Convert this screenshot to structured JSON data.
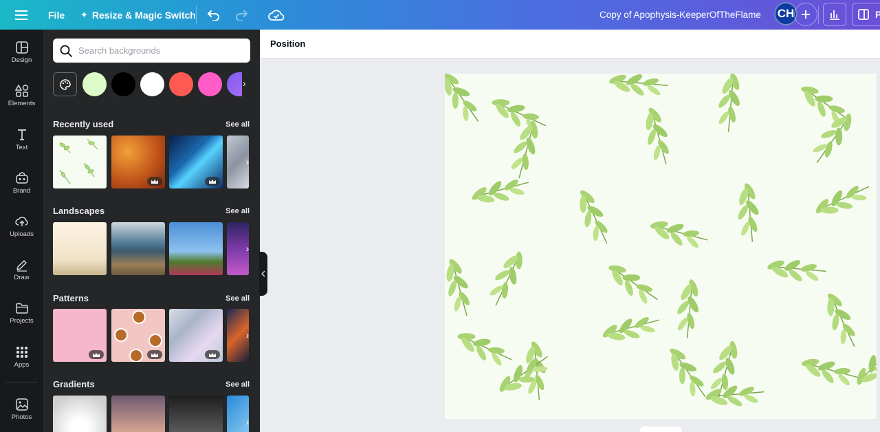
{
  "topbar": {
    "menu_icon": "hamburger-icon",
    "file_label": "File",
    "resize_label": "Resize & Magic Switch",
    "undo_icon": "undo-icon",
    "redo_icon": "redo-icon",
    "save_status_icon": "cloud-check-icon",
    "doc_title": "Copy of Apophysis-KeeperOfTheFlame",
    "avatar_initials": "CH",
    "present_label": "P"
  },
  "rail": {
    "items": [
      {
        "label": "Design",
        "icon": "layout-icon"
      },
      {
        "label": "Elements",
        "icon": "shapes-icon"
      },
      {
        "label": "Text",
        "icon": "text-icon"
      },
      {
        "label": "Brand",
        "icon": "brand-icon"
      },
      {
        "label": "Uploads",
        "icon": "cloud-upload-icon"
      },
      {
        "label": "Draw",
        "icon": "pen-icon"
      },
      {
        "label": "Projects",
        "icon": "folder-icon"
      },
      {
        "label": "Apps",
        "icon": "apps-grid-icon"
      },
      {
        "label": "Photos",
        "icon": "photo-icon"
      }
    ]
  },
  "panel": {
    "search_placeholder": "Search backgrounds",
    "swatch_colors": [
      "#dcfbc8",
      "#000000",
      "#ffffff",
      "#ff5a52",
      "#ff5cc8",
      "#a86cf0"
    ],
    "sections": [
      {
        "title": "Recently used",
        "see_all": "See all"
      },
      {
        "title": "Landscapes",
        "see_all": "See all"
      },
      {
        "title": "Patterns",
        "see_all": "See all"
      },
      {
        "title": "Gradients",
        "see_all": "See all"
      }
    ]
  },
  "workspace": {
    "position_label": "Position"
  },
  "colors": {
    "accent_gradient_start": "#1bb8c8",
    "accent_gradient_end": "#6a4fd8",
    "panel_bg": "#252627",
    "rail_bg": "#18191b"
  }
}
